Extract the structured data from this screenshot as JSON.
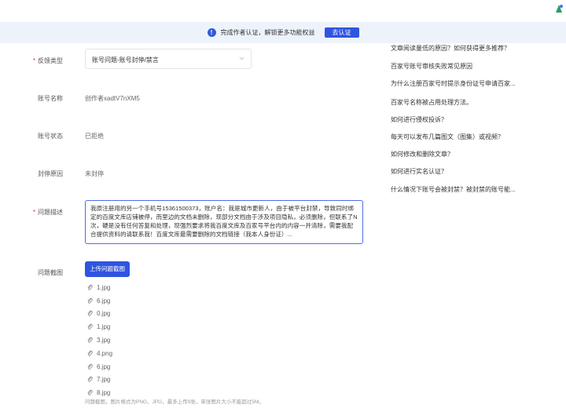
{
  "banner": {
    "text": "完成作者认证，解锁更多功能权益",
    "button_label": "去认证"
  },
  "form": {
    "feedback_type": {
      "label": "反馈类型",
      "value": "账号问题-账号封停/禁言"
    },
    "account_name": {
      "label": "账号名称",
      "value": "创作者xadtV7nXM5"
    },
    "account_status": {
      "label": "账号状态",
      "value": "已拒绝"
    },
    "ban_reason": {
      "label": "封停原因",
      "value": "未封停"
    },
    "description": {
      "label": "问题描述",
      "value": "我原注册用的另一个手机号15361500373，账户名：我是城市更新人，由于被平台封禁，导致同时绑定的百度文库店铺被停，而里边的文档未删除，现部分文档由于涉及项目隐私，必须删除，但联系了N次，硬是没有任何答复和处理，现强烈要求将我百度文库及百家号平台内的内容一并清除，需要我配合提供资料的请联系我！百度文库最需要删除的文档链接（我本人身份证）..."
    },
    "screenshots": {
      "label": "问题截图",
      "upload_label": "上传问题截图",
      "files": [
        "1.jpg",
        "6.jpg",
        "0.jpg",
        "1.jpg",
        "3.jpg",
        "4.png",
        "6.jpg",
        "7.jpg",
        "8.jpg"
      ],
      "hint": "问题截图，图片格式为PNG、JPG，最多上传9张，单张图片大小不能超过5M。"
    }
  },
  "faq": [
    "文章阅读量低的原因？如何获得更多推荐？",
    "百家号账号审核失败常见原因",
    "为什么注册百家号时提示身份证号申请百家...",
    "百家号名称被占用处理方法。",
    "如何进行侵权投诉？",
    "每天可以发布几篇图文（图集）或视频？",
    "如何修改和删除文章？",
    "如何进行实名认证？",
    "什么情况下账号会被封禁？被封禁的账号能..."
  ],
  "colors": {
    "accent": "#2f55e0",
    "required": "#e0321c",
    "banner_bg": "#eef3fb"
  }
}
